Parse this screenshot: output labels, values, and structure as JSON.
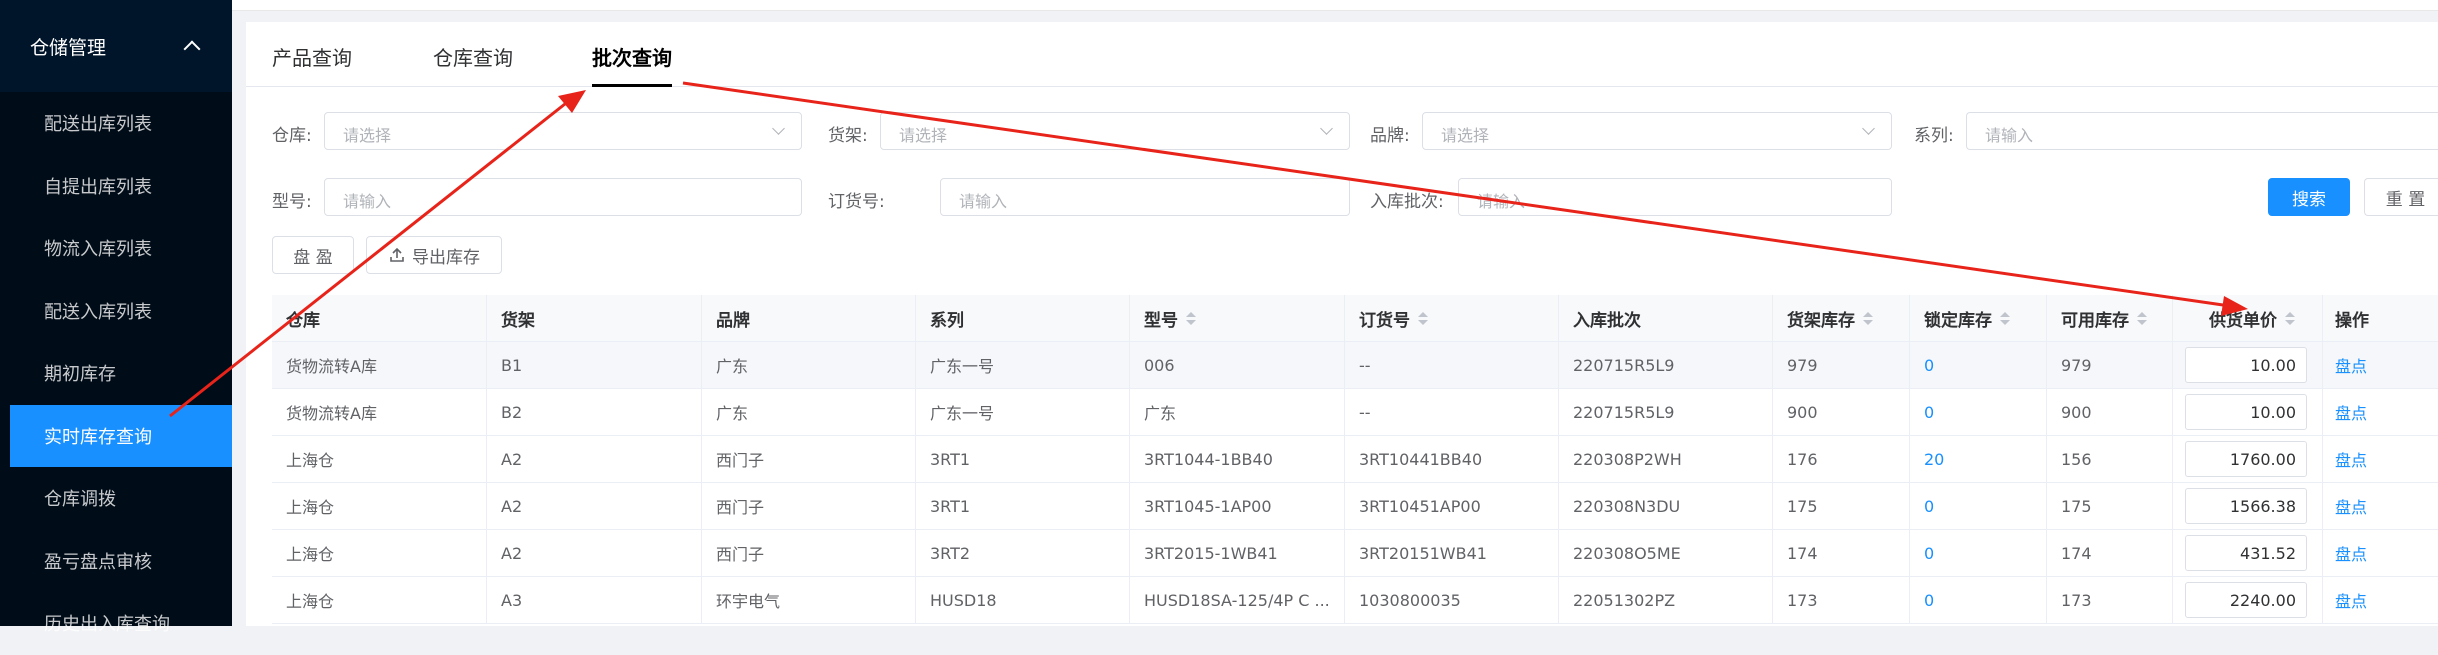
{
  "sidebar": {
    "group_label": "仓储管理",
    "items": [
      {
        "label": "配送出库列表"
      },
      {
        "label": "自提出库列表"
      },
      {
        "label": "物流入库列表"
      },
      {
        "label": "配送入库列表"
      },
      {
        "label": "期初库存"
      },
      {
        "label": "实时库存查询"
      },
      {
        "label": "仓库调拨"
      },
      {
        "label": "盈亏盘点审核"
      },
      {
        "label": "历史出入库查询"
      }
    ]
  },
  "tabs": [
    {
      "label": "产品查询"
    },
    {
      "label": "仓库查询"
    },
    {
      "label": "批次查询"
    }
  ],
  "filters": {
    "warehouse": {
      "label": "仓库:",
      "placeholder": "请选择"
    },
    "shelf": {
      "label": "货架:",
      "placeholder": "请选择"
    },
    "brand": {
      "label": "品牌:",
      "placeholder": "请选择"
    },
    "series": {
      "label": "系列:",
      "placeholder": "请输入"
    },
    "model": {
      "label": "型号:",
      "placeholder": "请输入"
    },
    "order_no": {
      "label": "订货号:",
      "placeholder": "请输入"
    },
    "batch": {
      "label": "入库批次:",
      "placeholder": "请输入"
    }
  },
  "buttons": {
    "search": "搜索",
    "reset": "重 置",
    "profit_check": "盘 盈",
    "export": "导出库存"
  },
  "table": {
    "headers": [
      "仓库",
      "货架",
      "品牌",
      "系列",
      "型号",
      "订货号",
      "入库批次",
      "货架库存",
      "锁定库存",
      "可用库存",
      "供货单价",
      "操作"
    ],
    "rows": [
      [
        "货物流转A库",
        "B1",
        "广东",
        "广东一号",
        "006",
        "--",
        "220715R5L9",
        "979",
        "0",
        "979",
        "10.00",
        "盘点"
      ],
      [
        "货物流转A库",
        "B2",
        "广东",
        "广东一号",
        "广东",
        "--",
        "220715R5L9",
        "900",
        "0",
        "900",
        "10.00",
        "盘点"
      ],
      [
        "上海仓",
        "A2",
        "西门子",
        "3RT1",
        "3RT1044-1BB40",
        "3RT10441BB40",
        "220308P2WH",
        "176",
        "20",
        "156",
        "1760.00",
        "盘点"
      ],
      [
        "上海仓",
        "A2",
        "西门子",
        "3RT1",
        "3RT1045-1AP00",
        "3RT10451AP00",
        "220308N3DU",
        "175",
        "0",
        "175",
        "1566.38",
        "盘点"
      ],
      [
        "上海仓",
        "A2",
        "西门子",
        "3RT2",
        "3RT2015-1WB41",
        "3RT20151WB41",
        "220308O5ME",
        "174",
        "0",
        "174",
        "431.52",
        "盘点"
      ],
      [
        "上海仓",
        "A3",
        "环宇电气",
        "HUSD18",
        "HUSD18SA-125/4P C ...",
        "1030800035",
        "22051302PZ",
        "173",
        "0",
        "173",
        "2240.00",
        "盘点"
      ]
    ]
  },
  "colors": {
    "accent": "#1890ff",
    "sidebar_bg": "#001529",
    "arrow": "#e8231a"
  },
  "icons": {
    "sidebar_toggle": "chevron-up-icon",
    "export": "upload-icon",
    "select": "chevron-down-icon",
    "sort": "sort-caret-icon"
  }
}
